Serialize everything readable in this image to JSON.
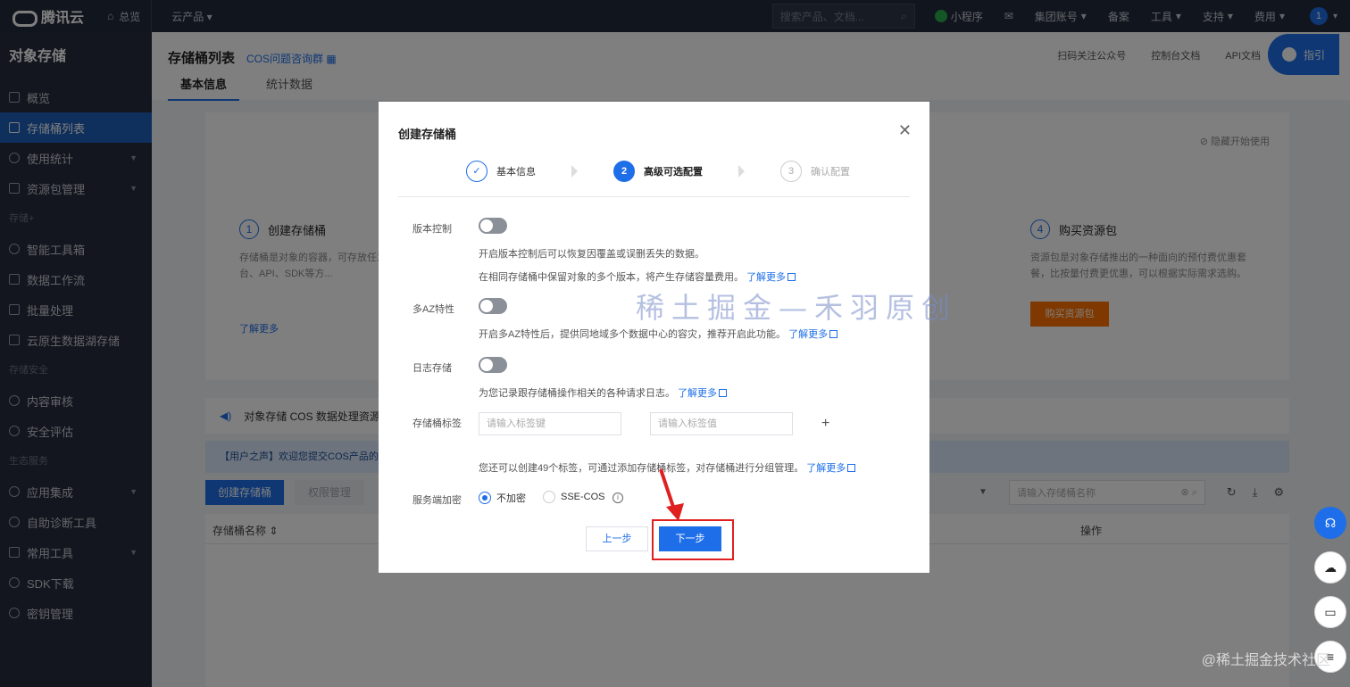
{
  "topbar": {
    "brand": "腾讯云",
    "home": "总览",
    "products": "云产品",
    "search_placeholder": "搜索产品、文档...",
    "items": [
      "小程序",
      "集团账号",
      "备案",
      "工具",
      "支持",
      "费用"
    ],
    "avatar": "1"
  },
  "sidebar": {
    "title": "对象存储",
    "items": [
      {
        "label": "概览"
      },
      {
        "label": "存储桶列表"
      },
      {
        "label": "使用统计"
      },
      {
        "label": "资源包管理"
      }
    ],
    "group_plus": "存储+",
    "plus_items": [
      "智能工具箱",
      "数据工作流",
      "批量处理",
      "云原生数据湖存储"
    ],
    "group_security": "存储安全",
    "security_items": [
      "内容审核",
      "安全评估"
    ],
    "group_eco": "生态服务",
    "eco_items": [
      "应用集成",
      "自助诊断工具",
      "常用工具",
      "SDK下载",
      "密钥管理"
    ]
  },
  "page": {
    "title": "存储桶列表",
    "group_link": "COS问题咨询群",
    "head_links": [
      "扫码关注公众号",
      "控制台文档",
      "API文档"
    ],
    "guide": "指引",
    "tabs": [
      "基本信息",
      "统计数据"
    ],
    "hide_guide": "隐藏开始使用",
    "step1": {
      "num": "1",
      "title": "创建存储桶",
      "desc": "存储桶是对象的容器，可存放任意...您可通过控制台、API、SDK等方...",
      "link": "了解更多"
    },
    "step4": {
      "num": "4",
      "title": "购买资源包",
      "desc": "资源包是对象存储推出的一种面向的预付费优惠套餐，比按量付费更优惠，可以根据实际需求选购。",
      "button": "购买资源包"
    },
    "notice": "对象存储 COS 数据处理资源包...",
    "voice_banner": "【用户之声】欢迎您提交COS产品的中...",
    "create_button": "创建存储桶",
    "perm_button": "权限管理",
    "bucket_search_placeholder": "请输入存储桶名称",
    "col_name": "存储桶名称",
    "col_op": "操作"
  },
  "modal": {
    "title": "创建存储桶",
    "steps": [
      {
        "num": "✓",
        "label": "基本信息"
      },
      {
        "num": "2",
        "label": "高级可选配置"
      },
      {
        "num": "3",
        "label": "确认配置"
      }
    ],
    "versioning": {
      "label": "版本控制",
      "enabled": false,
      "hint1": "开启版本控制后可以恢复因覆盖或误删丢失的数据。",
      "hint2": "在相同存储桶中保留对象的多个版本，将产生存储容量费用。",
      "link": "了解更多"
    },
    "multi_az": {
      "label": "多AZ特性",
      "enabled": false,
      "hint": "开启多AZ特性后，提供同地域多个数据中心的容灾，推荐开启此功能。",
      "link": "了解更多"
    },
    "logging": {
      "label": "日志存储",
      "enabled": false,
      "hint": "为您记录跟存储桶操作相关的各种请求日志。",
      "link": "了解更多"
    },
    "tags": {
      "label": "存储桶标签",
      "key_placeholder": "请输入标签键",
      "value_placeholder": "请输入标签值",
      "add": "+",
      "hint": "您还可以创建49个标签，可通过添加存储桶标签，对存储桶进行分组管理。",
      "link": "了解更多"
    },
    "encryption": {
      "label": "服务端加密",
      "options": [
        "不加密",
        "SSE-COS"
      ],
      "selected": "不加密"
    },
    "prev_button": "上一步",
    "next_button": "下一步",
    "watermark": "稀土掘金—禾羽原创"
  },
  "footer_watermark": "@稀土掘金技术社区",
  "colors": {
    "primary": "#1d6ee8",
    "highlight": "#e02020",
    "buy": "#ff7200"
  }
}
